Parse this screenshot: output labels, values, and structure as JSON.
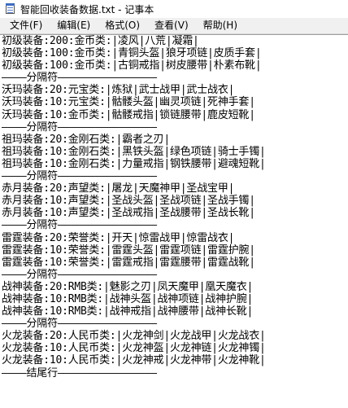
{
  "window": {
    "title": "智能回收装备数据.txt - 记事本"
  },
  "menu": [
    "文件(F)",
    "编辑(E)",
    "格式(O)",
    "查看(V)",
    "帮助(H)"
  ],
  "lines": [
    "初级装备:200:金币类:|凌风|八荒|凝霜|",
    "初级装备:100:金币类:|青铜头盔|狼牙项链|皮质手套|",
    "初级装备:100:金币类:|古铜戒指|树皮腰带|朴素布靴|",
    "————分隔符————————————————",
    "沃玛装备:20:元宝类:|炼狱|武士战甲|武士战衣|",
    "沃玛装备:10:元宝类:|骷髅头盔|幽灵项链|死神手套|",
    "沃玛装备:10:金币类:|骷髅戒指|锁链腰带|鹿皮短靴|",
    "————分隔符————————————————",
    "祖玛装备:20:金刚石类:|霸者之刃|",
    "祖玛装备:10:金刚石类:|黑铁头盔|绿色项链|骑士手镯|",
    "祖玛装备:10:金刚石类:|力量戒指|钢铁腰带|避魂短靴|",
    "————分隔符————————————————",
    "赤月装备:20:声望类:|屠龙|天魔神甲|圣战宝甲|",
    "赤月装备:10:声望类:|圣战头盔|圣战项链|圣战手镯|",
    "赤月装备:10:声望类:|圣战戒指|圣战腰带|圣战长靴|",
    "————分隔符————————————————",
    "雷霆装备:20:荣誉类:|开天|惊雷战甲|惊雷战衣|",
    "雷霆装备:10:荣誉类:|雷霆头盔|雷霆项链|雷霆护腕|",
    "雷霆装备:10:荣誉类:|雷霆戒指|雷霆腰带|雷霆战靴|",
    "————分隔符————————————————",
    "战神装备:20:RMB类:|魅影之刃|凤天魔甲|凰天魔衣|",
    "战神装备:10:RMB类:|战神头盔|战神项链|战神护腕|",
    "战神装备:10:RMB类:|战神戒指|战神腰带|战神长靴|",
    "————分隔符————————————————",
    "火龙装备:20:人民币类:|火龙神剑|火龙战甲|火龙战衣|",
    "火龙装备:10:人民币类:|火龙神盔|火龙神链|火龙神镯|",
    "火龙装备:10:人民币类:|火龙神戒|火龙神带|火龙神靴|",
    "————结尾行————————————————"
  ]
}
